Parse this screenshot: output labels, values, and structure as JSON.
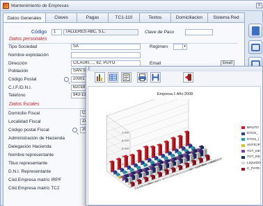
{
  "window": {
    "title": "Mantenimiento de Empresas",
    "close": "X"
  },
  "tabs": [
    "Datos Generales",
    "Claves",
    "Pagas",
    "TC1-110",
    "Textos",
    "Domiciliacion",
    "Sistema Red"
  ],
  "header": {
    "codigo_label": "Código",
    "codigo_value": "1",
    "company_name": "TALLERES ABC, S.L.",
    "clave_paso_label": "Clave de Paso"
  },
  "personales": {
    "section_label": "Datos personales",
    "tipo_sociedad_label": "Tipo Sociedad",
    "tipo_sociedad_value": "SA",
    "regimen_label": "Regimen",
    "nombre_explotacion_label": "Nombre explotación",
    "direccion_label": "Dirección",
    "direccion_value": "C/LAUKI...., 62, PUYO",
    "email_label": "Email",
    "email_button": "Email",
    "poblacion_label": "Población",
    "poblacion_value": "SAN SE",
    "codigo_postal_label": "Código Postal",
    "codigo_postal_value": "20001",
    "cif_label": "C.I.F./D.N.I.",
    "cif_value": "B2018",
    "telefono_label": "Telefono",
    "telefono_value": "943-13"
  },
  "fiscales": {
    "section_label": "Datos fiscales",
    "domicilio_label": "Domicilio Fiscal",
    "domicilio_value": "CL",
    "localidad_label": "Localidad Fiscal",
    "localidad_value": "ZA",
    "cp_label": "Código postal Fiscal",
    "cp_value": "20",
    "admin_label": "Administración de Hacienda",
    "delegacion_label": "Delegación Hacienda",
    "nombre_rep_label": "Nombre representante",
    "titulo_rep_label": "Tituo representante",
    "dni_rep_label": "D.N.I. Representante",
    "irpf_label": "Cód.Empresa matríc IRPF",
    "tc2_label": "Cód.Empresa matríc TC2"
  },
  "chart_window": {
    "title_icon": "ℰ",
    "heading": "Empresa:1   Año:2008"
  },
  "chart_data": {
    "type": "bar",
    "title": "Empresa:1   Año:2008",
    "note": "3D grouped bar chart; monthly values per concept (approximate, read from image)",
    "categories": [
      "ENERO",
      "FEBRERO",
      "MARZO",
      "ABRIL",
      "MAYO",
      "JUNIO",
      "JULIO",
      "AGOSTO",
      "SEPTIEMBRE",
      "OCTUBRE",
      "NOVIEMBRE",
      "DICIEMBRE"
    ],
    "series": [
      {
        "name": "BRUTO",
        "color": "#e0141e",
        "values": [
          1200,
          1250,
          1300,
          1150,
          1400,
          1600,
          1300,
          1250,
          1350,
          1500,
          1450,
          1700
        ]
      },
      {
        "name": "DTOS_",
        "color": "#2c3e9c",
        "values": [
          220,
          230,
          240,
          210,
          260,
          300,
          240,
          230,
          250,
          280,
          270,
          320
        ]
      },
      {
        "name": "DTOS_I",
        "color": "#1f9fb6",
        "values": [
          160,
          170,
          175,
          150,
          190,
          220,
          175,
          170,
          185,
          205,
          195,
          235
        ]
      },
      {
        "name": "ANTICIP",
        "color": "#d4c321",
        "values": [
          60,
          0,
          80,
          40,
          0,
          120,
          0,
          50,
          70,
          0,
          90,
          110
        ]
      },
      {
        "name": "TOT_DE",
        "color": "#7c3fa3",
        "values": [
          380,
          400,
          420,
          370,
          450,
          520,
          415,
          400,
          440,
          485,
          465,
          540
        ]
      },
      {
        "name": "TOT_RE",
        "color": "#1e2a6e",
        "values": [
          820,
          850,
          880,
          780,
          950,
          1080,
          885,
          850,
          910,
          1015,
          985,
          1160
        ]
      },
      {
        "name": "LIQUIDO",
        "color": "#d8d8d8",
        "values": [
          760,
          850,
          800,
          740,
          950,
          960,
          885,
          800,
          840,
          1015,
          895,
          1050
        ]
      },
      {
        "name": "C_PATR",
        "color": "#a01020",
        "values": [
          380,
          390,
          405,
          360,
          440,
          500,
          405,
          390,
          420,
          465,
          450,
          530
        ]
      }
    ],
    "z_ticks": [
      "7.000",
      "6.000",
      "5.000",
      "4.000",
      "3.000",
      "2.000",
      "1.000"
    ]
  }
}
